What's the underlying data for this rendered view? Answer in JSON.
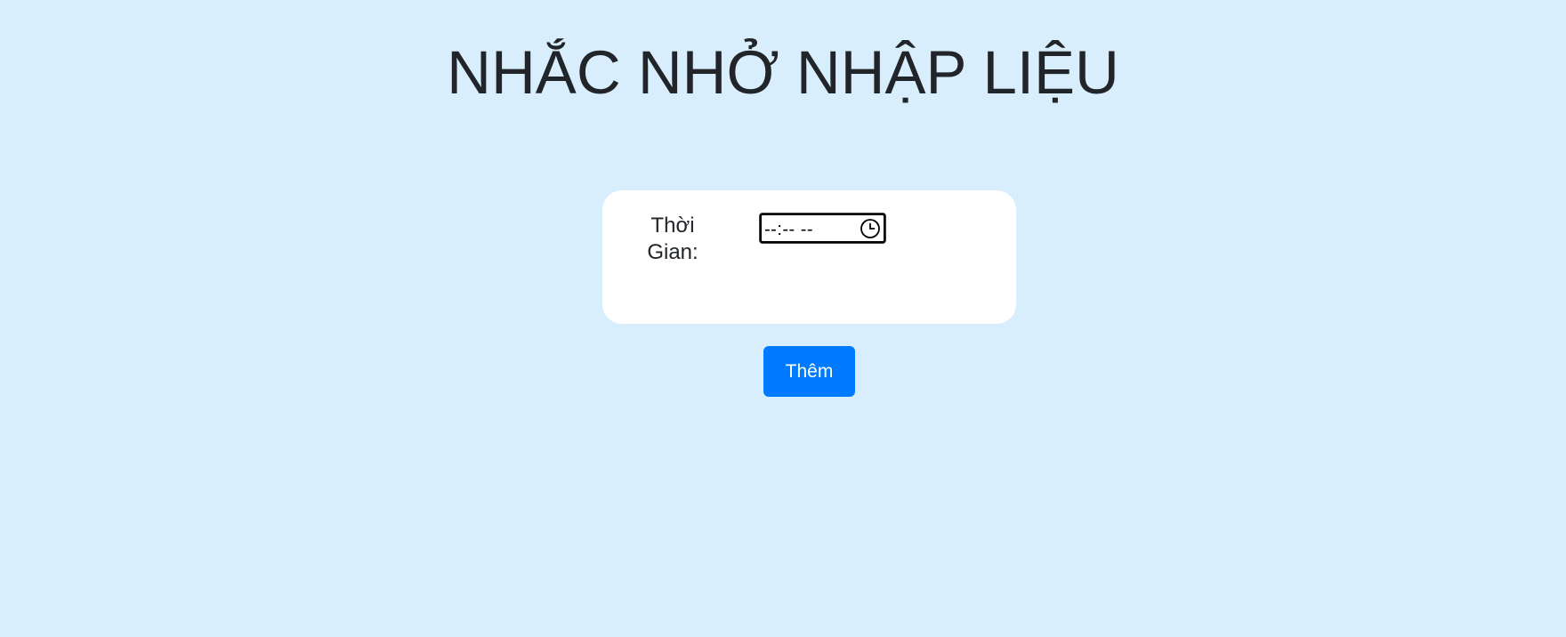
{
  "page": {
    "title": "NHẮC NHỞ NHẬP LIỆU"
  },
  "form": {
    "time_label_line1": "Thời",
    "time_label_line2": "Gian:",
    "time_input_value": "--:-- --",
    "time_input_icon": "clock-icon"
  },
  "actions": {
    "add_label": "Thêm"
  },
  "colors": {
    "background": "#d9eefc",
    "card": "#ffffff",
    "button": "#007bff",
    "button_text": "#ffffff",
    "text": "#212529"
  }
}
